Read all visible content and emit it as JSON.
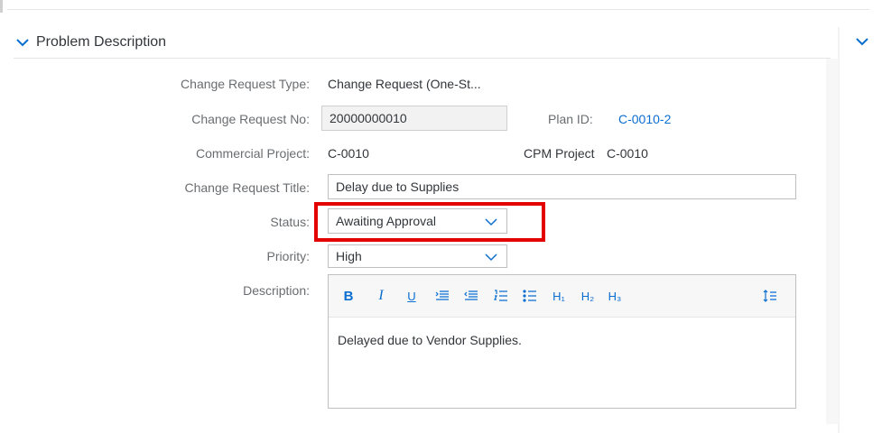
{
  "panel": {
    "title": "Problem Description"
  },
  "fields": {
    "request_type": {
      "label": "Change Request Type:",
      "value": "Change Request (One-St..."
    },
    "request_no": {
      "label": "Change Request No:",
      "value": "20000000010"
    },
    "plan_id": {
      "label": "Plan ID:",
      "value": "C-0010-2"
    },
    "commercial_project": {
      "label": "Commercial Project:",
      "value": "C-0010"
    },
    "cpm_project": {
      "label": "CPM Project",
      "value": "C-0010"
    },
    "request_title": {
      "label": "Change Request Title:",
      "value": "Delay due to Supplies"
    },
    "status": {
      "label": "Status:",
      "value": "Awaiting Approval"
    },
    "priority": {
      "label": "Priority:",
      "value": "High"
    },
    "description": {
      "label": "Description:",
      "value": "Delayed due to Vendor Supplies."
    }
  },
  "editor": {
    "toolbar": {
      "bold": "B",
      "italic": "I",
      "underline": "U",
      "h1": "H₁",
      "h2": "H₂",
      "h3": "H₃"
    }
  },
  "icons": {
    "panel_chevron": "chevron-down-icon",
    "select_caret": "chevron-down-icon"
  },
  "colors": {
    "link": "#0a6ed1",
    "highlight": "#e30000",
    "label": "#6a6d70"
  }
}
